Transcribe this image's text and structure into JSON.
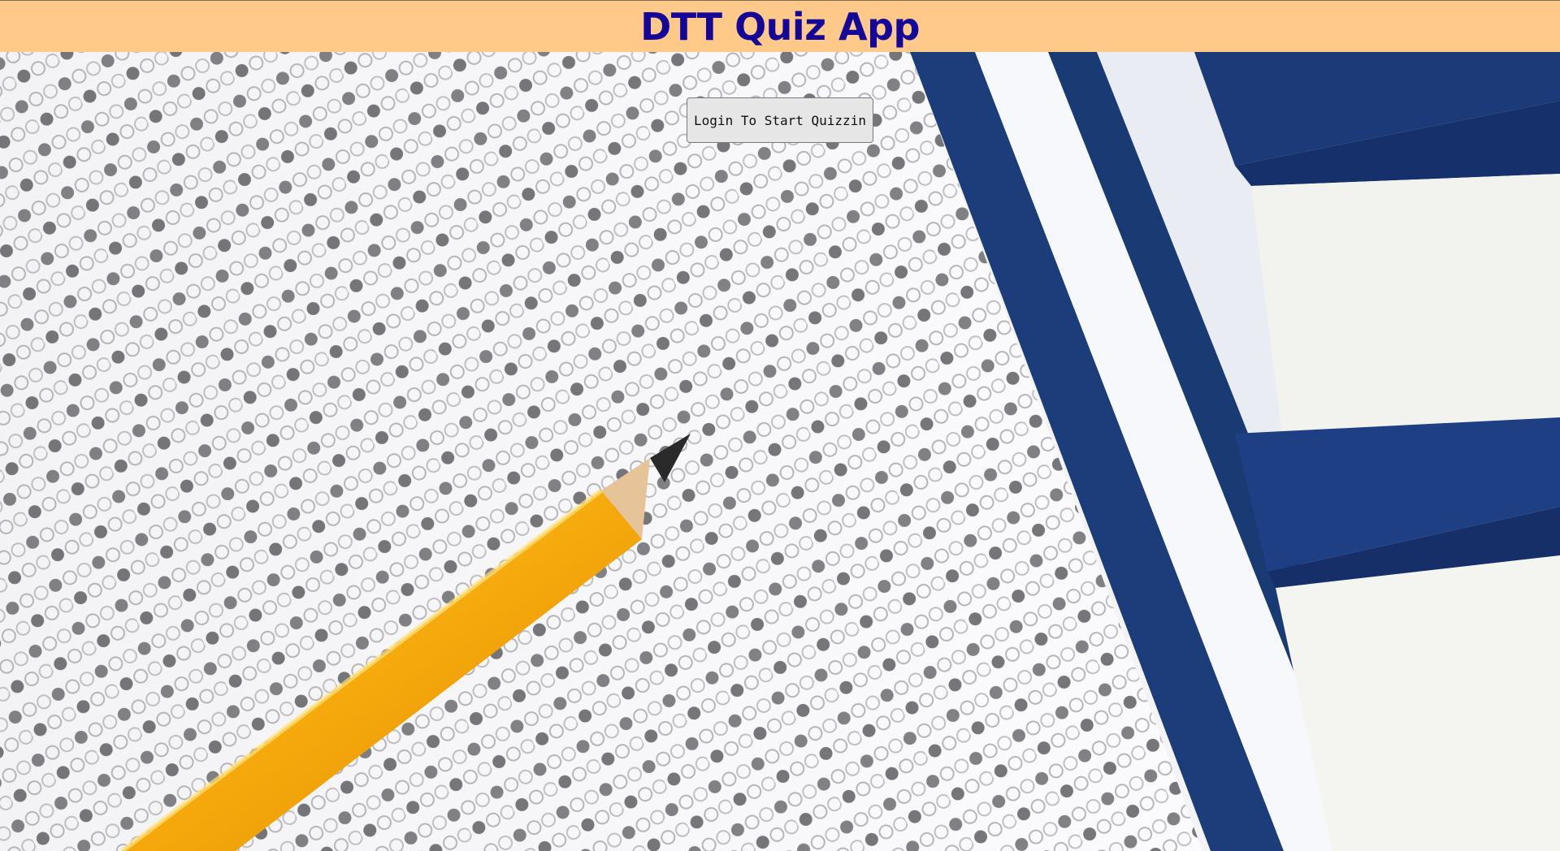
{
  "header": {
    "title": "DTT Quiz App"
  },
  "login": {
    "label": "Login To Start Quizzin"
  },
  "colors": {
    "header_bg": "#ffc98a",
    "title_color": "#15069a",
    "button_bg": "#e6e6e6"
  },
  "background": {
    "description_icon": "answer-sheet-with-pencil-image"
  }
}
